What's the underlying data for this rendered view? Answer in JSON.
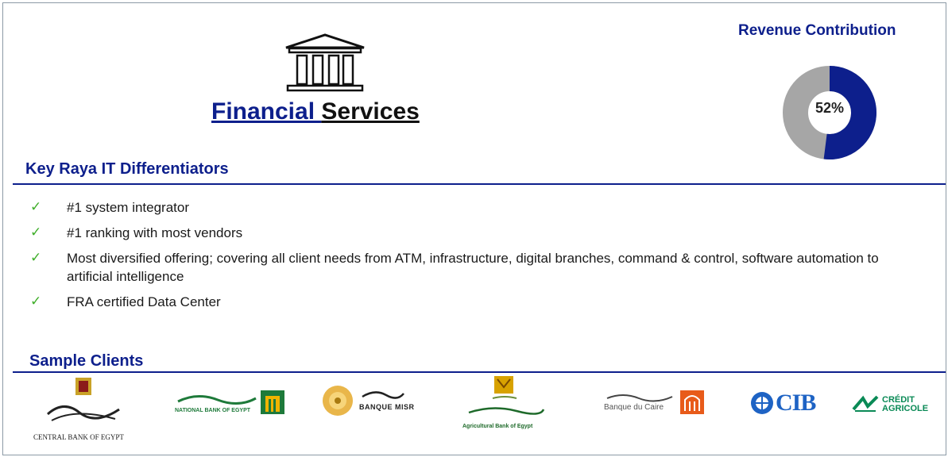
{
  "header": {
    "title_part1": "Financial ",
    "title_part2": "Services",
    "bank_icon": "bank-building-icon"
  },
  "revenue": {
    "title": "Revenue Contribution",
    "percent_label": "52%",
    "value": 0.52,
    "fill_color": "#0d1f8c",
    "rest_color": "#a6a6a6"
  },
  "differentiators": {
    "heading": "Key Raya IT Differentiators",
    "items": [
      "#1 system integrator",
      "#1 ranking with most vendors",
      "Most diversified offering; covering all client needs from ATM, infrastructure, digital branches, command & control, software automation to artificial intelligence",
      "FRA certified Data Center"
    ],
    "check_color": "#3fae2a"
  },
  "clients": {
    "heading": "Sample Clients",
    "logos": [
      {
        "name": "central-bank-of-egypt-logo",
        "text": "CENTRAL BANK OF EGYPT"
      },
      {
        "name": "national-bank-of-egypt-logo",
        "text": "NATIONAL BANK OF EGYPT"
      },
      {
        "name": "banque-misr-logo",
        "text": "BANQUE MISR"
      },
      {
        "name": "agricultural-bank-of-egypt-logo",
        "text": "Agricultural Bank of Egypt"
      },
      {
        "name": "banque-du-caire-logo",
        "text": "Banque du Caire"
      },
      {
        "name": "cib-logo",
        "text": "CIB"
      },
      {
        "name": "credit-agricole-logo",
        "text": "CRÉDIT AGRICOLE"
      }
    ]
  },
  "colors": {
    "accent": "#0d1f8c",
    "border": "#8c9aa6"
  }
}
